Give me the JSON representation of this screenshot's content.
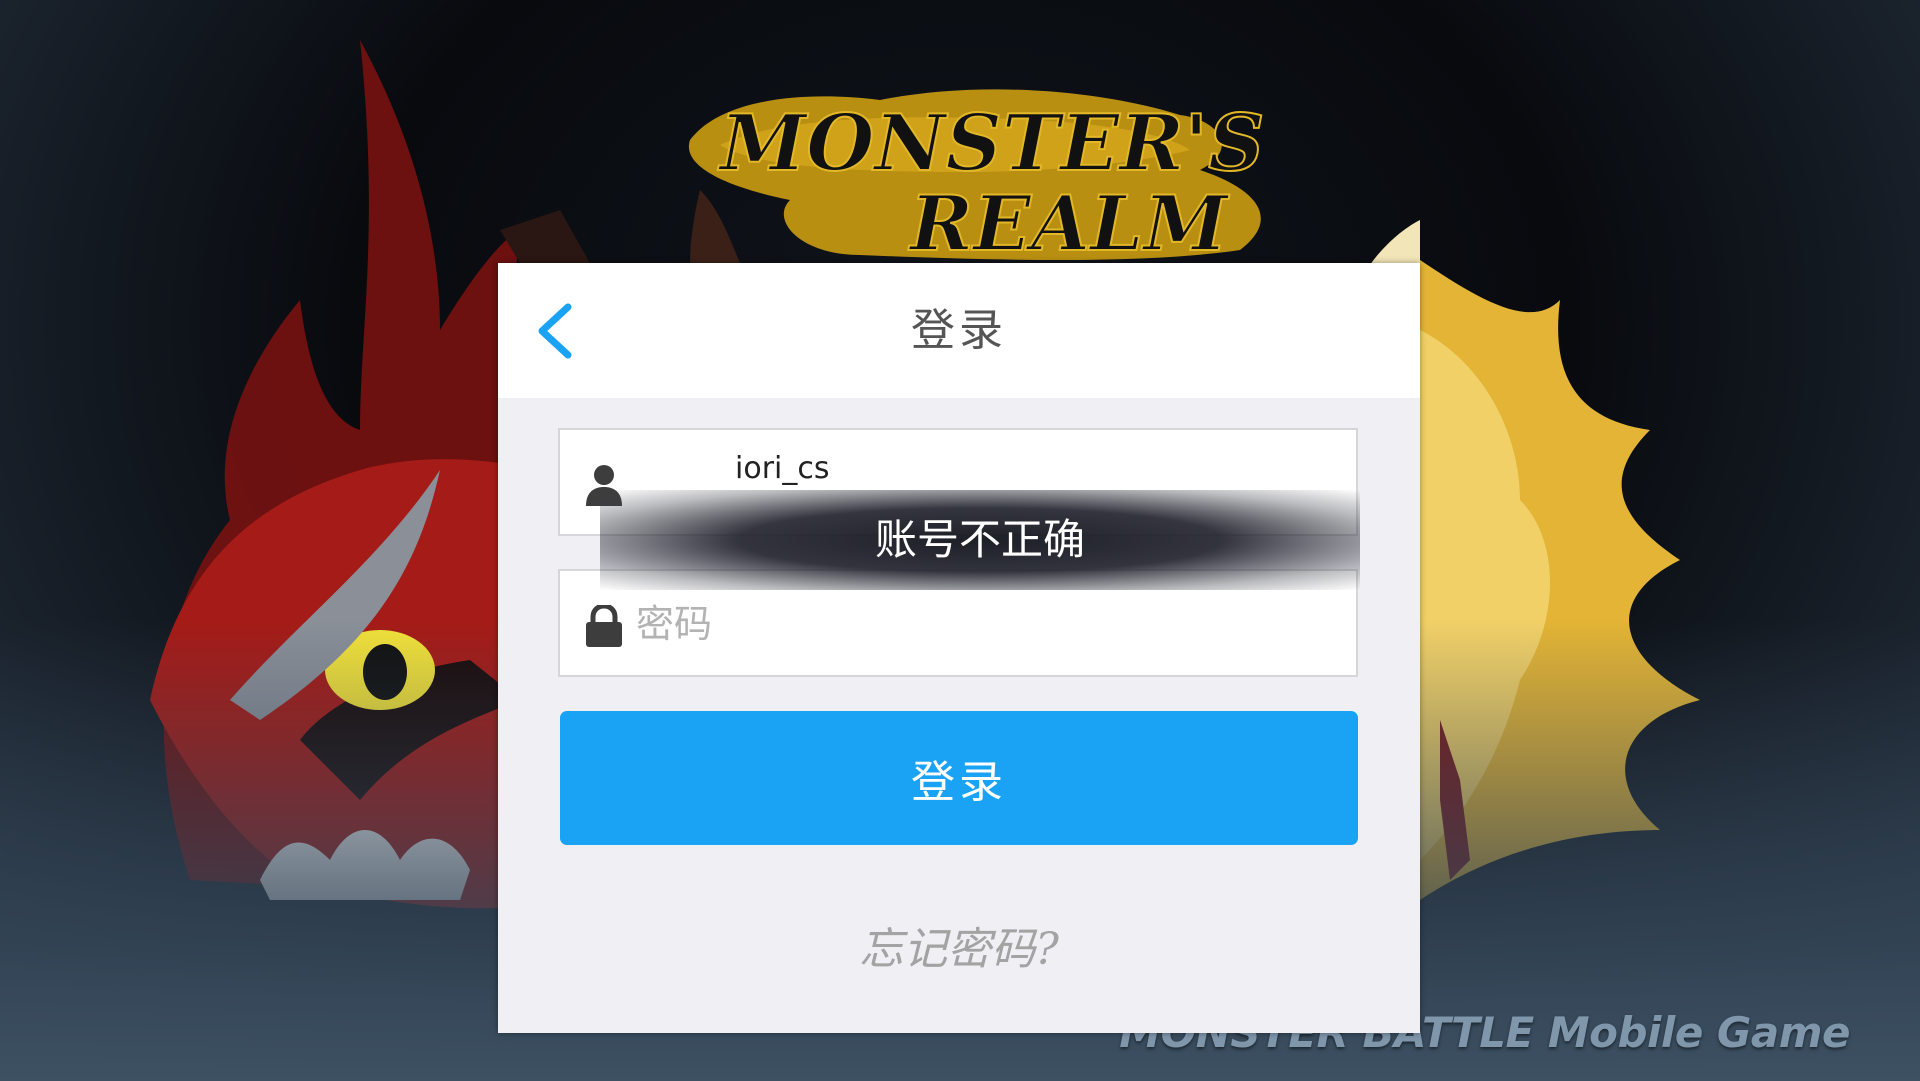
{
  "background": {
    "logo_text": "MONSTER'S REALM",
    "footer_text": "MONSTER BATTLE Mobile Game"
  },
  "login_panel": {
    "title": "登录",
    "back_icon": "chevron-left-icon",
    "username": {
      "icon": "user-icon",
      "value": "iori_cs"
    },
    "password": {
      "icon": "lock-icon",
      "value": "",
      "placeholder": "密码"
    },
    "submit_label": "登录",
    "forgot_label": "忘记密码?"
  },
  "toast": {
    "message": "账号不正确"
  },
  "colors": {
    "accent": "#1aa3f5",
    "panel_bg": "#efeff4",
    "header_bg": "#ffffff",
    "muted_text": "#a3a3a3"
  }
}
